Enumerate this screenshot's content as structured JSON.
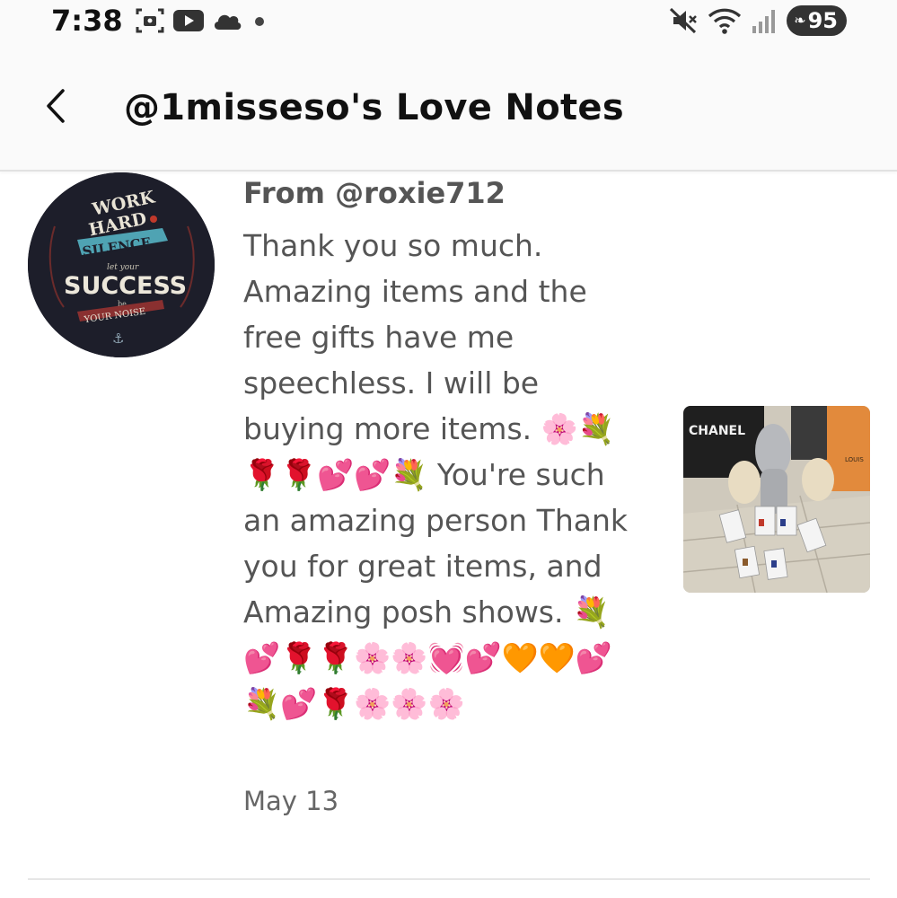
{
  "status_bar": {
    "time": "7:38",
    "battery": "95",
    "icons_left": [
      "screenshot-icon",
      "youtube-icon",
      "cloud-icon",
      "dot-icon"
    ],
    "icons_right": [
      "mute-icon",
      "wifi-icon",
      "signal-icon",
      "battery-icon"
    ]
  },
  "header": {
    "title": "@1misseso's Love Notes",
    "back_icon": "chevron-left-icon"
  },
  "note": {
    "from": "From @roxie712",
    "message": "Thank you so much. Amazing items and the free gifts have me speechless. I will be buying more items. 🌸💐🌹🌹💕💕💐 You're such an amazing person Thank you for great items, and Amazing posh shows. 💐💕🌹🌹🌸🌸💓💕🧡🧡💕💐💕🌹🌸🌸🌸",
    "date": "May 13",
    "avatar": {
      "line1": "WORK",
      "line2": "HARD",
      "line3": "SILENCE",
      "line4": "let your",
      "line5": "SUCCESS",
      "line6": "be",
      "line7": "YOUR NOISE"
    },
    "photo": {
      "brand1": "CHANEL",
      "brand2": "LOUIS"
    }
  },
  "colors": {
    "background": "#ffffff",
    "header_bg": "#fafafa",
    "text_primary": "#111111",
    "text_secondary": "#555555",
    "avatar_bg": "#1d1e2a",
    "avatar_teal": "#4fa3b3",
    "avatar_red": "#c0392b"
  }
}
